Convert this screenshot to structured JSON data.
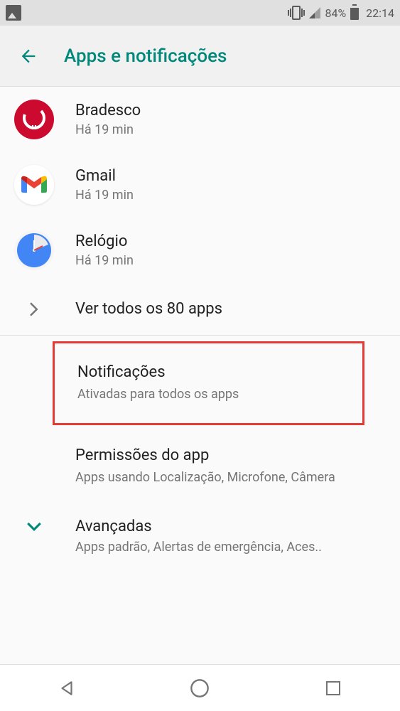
{
  "statusbar": {
    "battery": "84%",
    "time": "22:14"
  },
  "header": {
    "title": "Apps e notificações"
  },
  "apps": [
    {
      "name": "Bradesco",
      "subtitle": "Há 19 min"
    },
    {
      "name": "Gmail",
      "subtitle": "Há 19 min"
    },
    {
      "name": "Relógio",
      "subtitle": "Há 19 min"
    }
  ],
  "viewAll": "Ver todos os 80 apps",
  "settings": {
    "notifications": {
      "title": "Notificações",
      "subtitle": "Ativadas para todos os apps"
    },
    "permissions": {
      "title": "Permissões do app",
      "subtitle": "Apps usando Localização, Microfone, Câmera"
    },
    "advanced": {
      "title": "Avançadas",
      "subtitle": "Apps padrão, Alertas de emergência, Aces.."
    }
  },
  "colors": {
    "accent": "#00897b",
    "highlight": "#e53935"
  }
}
